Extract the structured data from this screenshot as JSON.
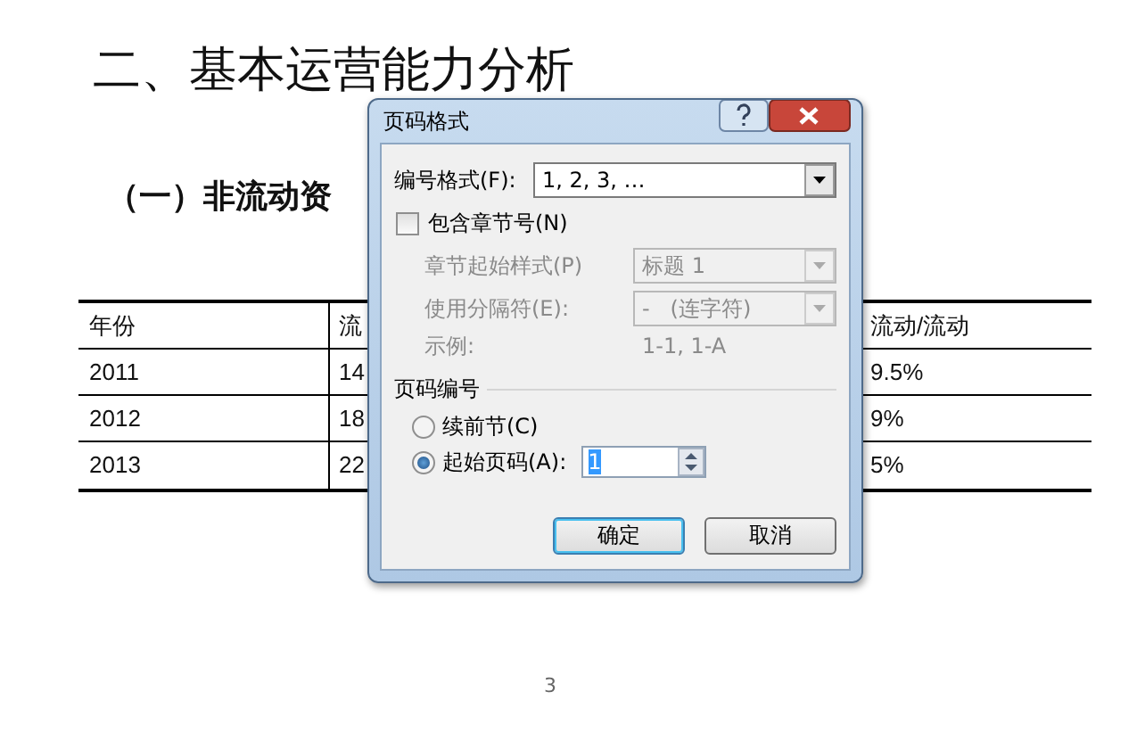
{
  "document": {
    "heading": "二、基本运营能力分析",
    "subheading": "（一）非流动资",
    "table": {
      "columns": [
        "年份",
        "流",
        "流动/流动"
      ],
      "rows": [
        [
          "2011",
          "14",
          "9.5%"
        ],
        [
          "2012",
          "18",
          "9%"
        ],
        [
          "2013",
          "22",
          "5%"
        ]
      ]
    },
    "page_number": "3"
  },
  "dialog": {
    "title": "页码格式",
    "number_format": {
      "label": "编号格式(F):",
      "value": "1, 2, 3, …"
    },
    "include_chapter": {
      "label": "包含章节号(N)",
      "checked": false
    },
    "chapter_style": {
      "label": "章节起始样式(P)",
      "value": "标题 1",
      "disabled": true
    },
    "separator": {
      "label": "使用分隔符(E):",
      "value": "-   (连字符)",
      "disabled": true
    },
    "example": {
      "label": "示例:",
      "value": "1-1, 1-A",
      "disabled": true
    },
    "numbering": {
      "title": "页码编号",
      "options": [
        {
          "label": "续前节(C)",
          "selected": false
        },
        {
          "label": "起始页码(A):",
          "selected": true
        }
      ],
      "start_at": "1"
    },
    "buttons": [
      {
        "label": "确定",
        "default": true
      },
      {
        "label": "取消",
        "default": false
      }
    ]
  }
}
